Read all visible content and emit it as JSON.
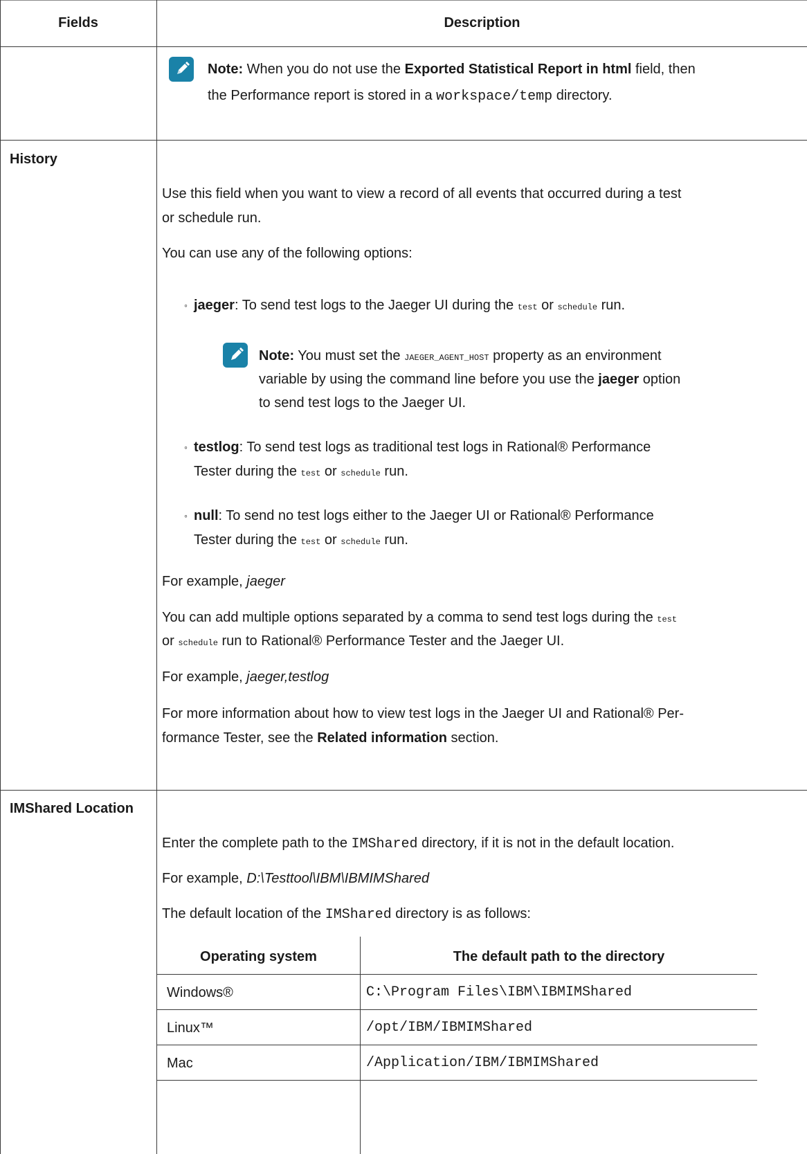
{
  "header": {
    "col1": "Fields",
    "col2": "Description"
  },
  "row_exported": {
    "note_label": "Note:",
    "note_part1": " When you do not use the ",
    "note_bold": "Exported Statistical Report in html",
    "note_part2": " field, then",
    "note_line2_part1": "the Performance report is stored in a ",
    "note_code": "workspace/temp",
    "note_line2_part2": " directory."
  },
  "row_history": {
    "field": "History",
    "p1_line1": "Use this field when you want to view a record of all events that occurred during a test",
    "p1_line2": "or schedule run.",
    "p2": "You can use any of the following options:",
    "opt_jaeger_bold": "jaeger",
    "opt_jaeger_text": ": To send test logs to the Jaeger UI during the ",
    "code_test": "test",
    "or": " or ",
    "code_schedule": "schedule",
    "run": " run.",
    "note2_label": "Note:",
    "note2_part1": " You must set the ",
    "note2_code": "JAEGER_AGENT_HOST",
    "note2_part2": " property as an environment",
    "note2_line2": "variable by using the command line before you use the ",
    "note2_bold": "jaeger",
    "note2_line2_end": " option",
    "note2_line3": "to send test logs to the Jaeger UI.",
    "opt_testlog_bold": "testlog",
    "opt_testlog_text": ": To send test logs as traditional test logs in  Rational® Performance",
    "opt_testlog_line2": "Tester during the ",
    "opt_null_bold": "null",
    "opt_null_text": ": To send no test logs either to the Jaeger UI or  Rational® Performance",
    "opt_null_line2": "Tester during the ",
    "example1_label": "For example, ",
    "example1_value": "jaeger",
    "p3_line1": "You can add multiple options separated by a comma to send test logs during the ",
    "p3_line2_start": "or ",
    "p3_line2_end": " run to  Rational® Performance Tester and the Jaeger UI.",
    "example2_label": "For example, ",
    "example2_value": "jaeger,testlog",
    "p4_line1": "For more information about how to view test logs in the Jaeger UI and  Rational® Per-",
    "p4_line2_start": "formance Tester, see the ",
    "p4_bold": "Related information",
    "p4_line2_end": " section."
  },
  "row_imshared": {
    "field": "IMShared Location",
    "p1_start": "Enter the complete path to the ",
    "p1_code": "IMShared",
    "p1_end": " directory, if it is not in the default location.",
    "example_label": "For example, ",
    "example_value": "D:\\Testtool\\IBM\\IBMIMShared",
    "p2_start": "The default location of the ",
    "p2_code": "IMShared",
    "p2_end": " directory is as follows:",
    "table": {
      "headers": [
        "Operating system",
        "The default path to the directory"
      ],
      "rows": [
        [
          "Windows®",
          "C:\\Program Files\\IBM\\IBMIMShared"
        ],
        [
          "Linux™",
          "/opt/IBM/IBMIMShared"
        ],
        [
          "Mac",
          "/Application/IBM/IBMIMShared"
        ]
      ]
    }
  }
}
